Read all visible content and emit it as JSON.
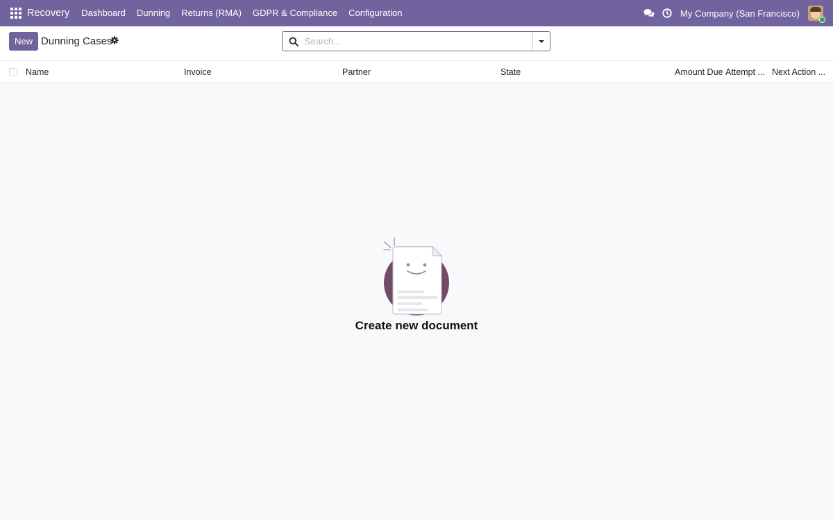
{
  "navbar": {
    "app_name": "Recovery",
    "menu": [
      {
        "label": "Dashboard"
      },
      {
        "label": "Dunning"
      },
      {
        "label": "Returns (RMA)"
      },
      {
        "label": "GDPR & Compliance"
      },
      {
        "label": "Configuration"
      }
    ],
    "company": "My Company (San Francisco)",
    "icons": {
      "apps": "grid-icon",
      "chat": "chat-icon",
      "activity": "clock-icon",
      "avatar": "user-avatar"
    },
    "colors": {
      "background": "#71639e"
    }
  },
  "control_panel": {
    "new_label": "New",
    "title": "Dunning Cases",
    "settings_icon": "gear-icon",
    "search": {
      "placeholder": "Search...",
      "value": ""
    }
  },
  "list": {
    "columns": [
      {
        "label": "Name"
      },
      {
        "label": "Invoice"
      },
      {
        "label": "Partner"
      },
      {
        "label": "State"
      },
      {
        "label": "Amount Due"
      },
      {
        "label": "Attempt ..."
      },
      {
        "label": "Next Action ..."
      }
    ],
    "rows": []
  },
  "empty_state": {
    "title": "Create new document"
  }
}
